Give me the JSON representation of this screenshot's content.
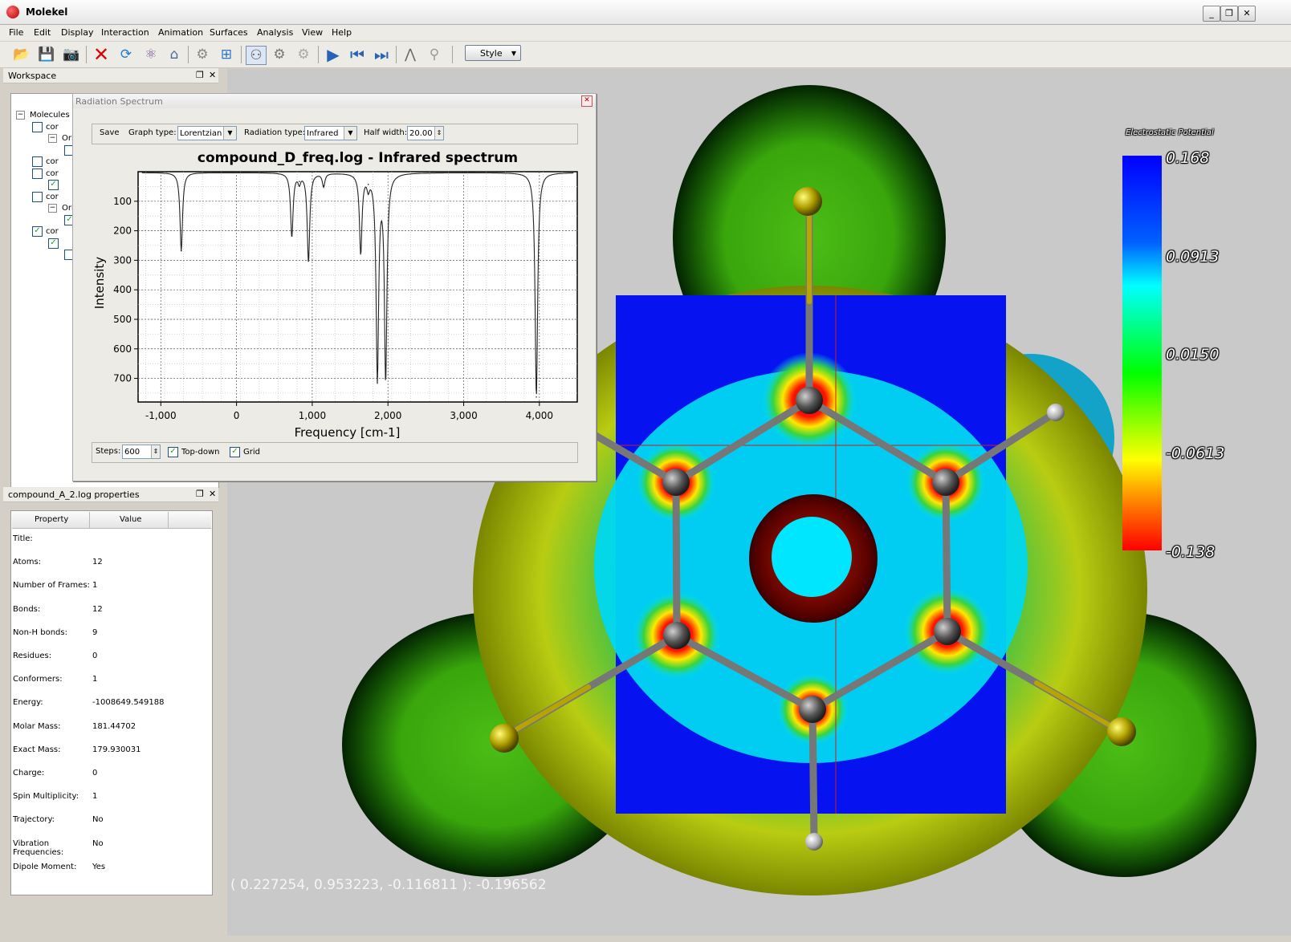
{
  "window": {
    "title": "Molekel",
    "buttons": [
      "_",
      "❐",
      "✕"
    ]
  },
  "menu": [
    "File",
    "Edit",
    "Display",
    "Interaction",
    "Animation",
    "Surfaces",
    "Analysis",
    "View",
    "Help"
  ],
  "toolbar": {
    "style_label": "Style"
  },
  "workspace": {
    "title": "Workspace",
    "root_label": "Molecules",
    "rows": [
      {
        "label": "cor",
        "checked": false
      },
      {
        "label": "Orb",
        "checked": null
      },
      {
        "label": "",
        "checked": false
      },
      {
        "label": "cor",
        "checked": false
      },
      {
        "label": "cor",
        "checked": false
      },
      {
        "label": "",
        "checked": true
      },
      {
        "label": "cor",
        "checked": false
      },
      {
        "label": "Orb",
        "checked": null
      },
      {
        "label": "",
        "checked": true
      },
      {
        "label": "cor",
        "checked": true
      },
      {
        "label": "",
        "checked": true
      },
      {
        "label": "",
        "checked": false
      }
    ]
  },
  "properties": {
    "title": "compound_A_2.log properties",
    "header_property": "Property",
    "header_value": "Value",
    "rows": [
      {
        "name": "Title:",
        "value": ""
      },
      {
        "name": "Atoms:",
        "value": "12"
      },
      {
        "name": "Number of Frames:",
        "value": "1"
      },
      {
        "name": "Bonds:",
        "value": "12"
      },
      {
        "name": "Non-H bonds:",
        "value": "9"
      },
      {
        "name": "Residues:",
        "value": "0"
      },
      {
        "name": "Conformers:",
        "value": "1"
      },
      {
        "name": "Energy:",
        "value": "-1008649.549188"
      },
      {
        "name": "Molar Mass:",
        "value": "181.44702"
      },
      {
        "name": "Exact Mass:",
        "value": "179.930031"
      },
      {
        "name": "Charge:",
        "value": "0"
      },
      {
        "name": "Spin Multiplicity:",
        "value": "1"
      },
      {
        "name": "Trajectory:",
        "value": "No"
      },
      {
        "name": "Vibration Frequencies:",
        "value": "No"
      },
      {
        "name": "Dipole Moment:",
        "value": "Yes"
      }
    ]
  },
  "spectrum": {
    "window_title": "Radiation Spectrum",
    "save_label": "Save",
    "graph_type_label": "Graph type:",
    "graph_type_value": "Lorentzian",
    "radiation_type_label": "Radiation type:",
    "radiation_type_value": "Infrared",
    "half_width_label": "Half width:",
    "half_width_value": "20.00",
    "steps_label": "Steps:",
    "steps_value": "600",
    "topdown_label": "Top-down",
    "grid_label": "Grid"
  },
  "chart_data": {
    "type": "line",
    "title": "compound_D_freq.log - Infrared spectrum",
    "xlabel": "Frequency [cm-1]",
    "ylabel": "Intensity",
    "xlim": [
      -1300,
      4500
    ],
    "ylim": [
      0,
      780
    ],
    "y_inverted": true,
    "grid": true,
    "x_ticks": [
      "-1,000",
      "0",
      "1,000",
      "2,000",
      "3,000",
      "4,000"
    ],
    "x_tick_values": [
      -1000,
      0,
      1000,
      2000,
      3000,
      4000
    ],
    "y_ticks": [
      "100",
      "200",
      "300",
      "400",
      "500",
      "600",
      "700"
    ],
    "y_tick_values": [
      100,
      200,
      300,
      400,
      500,
      600,
      700
    ],
    "peaks": [
      {
        "x": -730,
        "intensity": 265
      },
      {
        "x": 730,
        "intensity": 215
      },
      {
        "x": 830,
        "intensity": 30
      },
      {
        "x": 950,
        "intensity": 300
      },
      {
        "x": 1150,
        "intensity": 45
      },
      {
        "x": 1640,
        "intensity": 270
      },
      {
        "x": 1740,
        "intensity": 40
      },
      {
        "x": 1860,
        "intensity": 690
      },
      {
        "x": 1970,
        "intensity": 690
      },
      {
        "x": 3960,
        "intensity": 760
      }
    ]
  },
  "colorbar": {
    "title": "Electrostatic Potential",
    "labels": [
      "0.168",
      "0.0913",
      "0.0150",
      "-0.0613",
      "-0.138"
    ]
  },
  "coordinate_readout": "( 0.227254, 0.953223, -0.116811 ): -0.196562"
}
